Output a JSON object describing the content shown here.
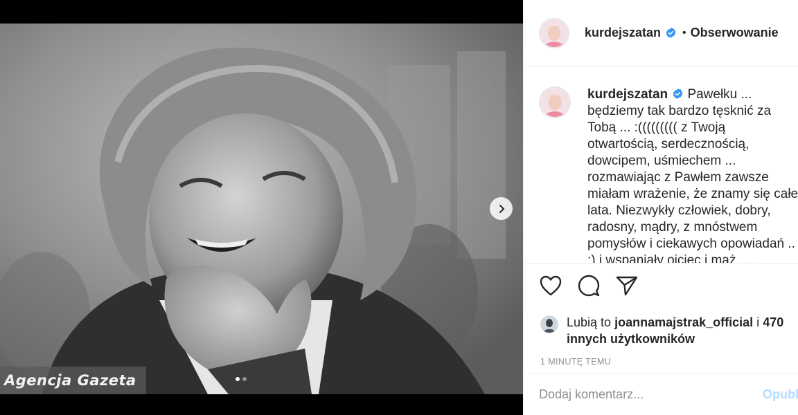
{
  "post": {
    "username": "kurdejszatan",
    "follow_separator": "•",
    "follow_status": "Obserwowanie",
    "caption_username": "kurdejszatan",
    "caption_text": "Pawełku ... będziemy tak bardzo tęsknić za Tobą ... :((((((((( z Twoją otwartością, serdecznością, dowcipem, uśmiechem ... rozmawiając z Pawłem zawsze miałam wrażenie, że znamy się całe lata. Niezwykły człowiek, dobry, radosny, mądry, z mnóstwem pomysłów i ciekawych opowiadań .. :) i wspaniały ojciec i mąż .... przykład do naśladowania .... do zobaczenia Pawełku ... kiedyś kiedyś ...",
    "likes_prefix": "Lubią to",
    "likes_user": "joannamajstrak_official",
    "likes_suffix": "i",
    "likes_others": "470 innych użytkowników",
    "time": "1 MINUTĘ TEMU",
    "comment_placeholder": "Dodaj komentarz...",
    "post_label": "Opublikuj"
  },
  "media": {
    "watermark": "Agencja Gazeta",
    "slide_count": 2,
    "current_slide": 1
  },
  "icons": {
    "verified": "verified-badge-icon",
    "like": "heart-icon",
    "comment": "comment-bubble-icon",
    "share": "paper-plane-icon",
    "next": "chevron-right-icon"
  },
  "colors": {
    "verified_blue": "#3897f0",
    "post_button_disabled": "#b3dbff",
    "secondary_text": "#8e8e8e"
  }
}
